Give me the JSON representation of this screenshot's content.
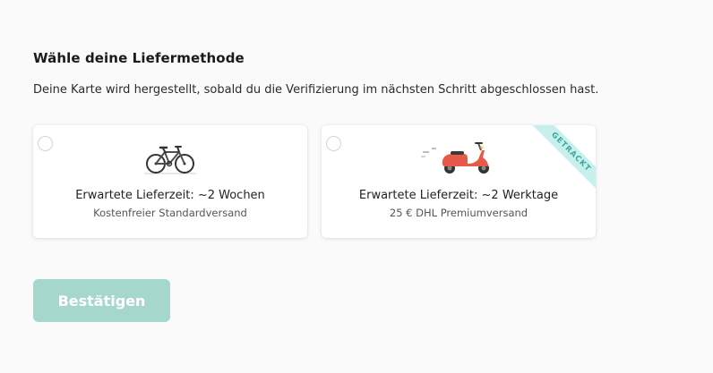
{
  "heading": "Wähle deine Liefermethode",
  "description": "Deine Karte wird hergestellt, sobald du die Verifizierung im nächsten Schritt abgeschlossen hast.",
  "options": [
    {
      "icon": "bicycle-icon",
      "eta": "Erwartete Lieferzeit: ~2 Wochen",
      "detail": "Kostenfreier Standardversand",
      "selected": false
    },
    {
      "icon": "scooter-icon",
      "eta": "Erwartete Lieferzeit: ~2 Werktage",
      "detail": "25 € DHL Premiumversand",
      "badge": "GETRACKT",
      "selected": false
    }
  ],
  "confirm_button": "Bestätigen",
  "colors": {
    "accent": "#a5d7cc",
    "badge_bg": "#c9efed",
    "badge_text": "#3aa9a0",
    "scooter": "#e8594a"
  }
}
